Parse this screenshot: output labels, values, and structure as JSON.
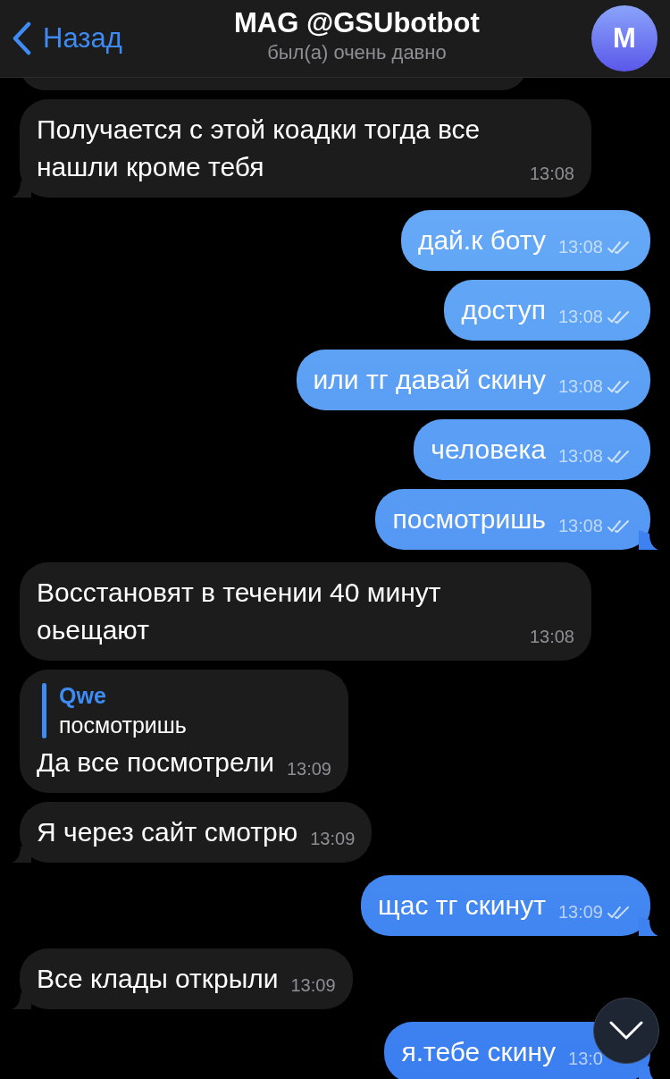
{
  "header": {
    "back_label": "Назад",
    "title": "MAG @GSUbotbot",
    "status": "был(а) очень давно",
    "avatar_initial": "M"
  },
  "messages": [
    {
      "kind": "incoming",
      "text": "Получается с этой коадки тогда все нашли кроме тебя",
      "time": "13:08"
    },
    {
      "kind": "outgoing",
      "text": "дай.к боту",
      "time": "13:08",
      "ticks": true
    },
    {
      "kind": "outgoing",
      "text": "доступ",
      "time": "13:08",
      "ticks": true
    },
    {
      "kind": "outgoing",
      "text": "или тг давай скину",
      "time": "13:08",
      "ticks": true
    },
    {
      "kind": "outgoing",
      "text": "человека",
      "time": "13:08",
      "ticks": true
    },
    {
      "kind": "outgoing",
      "text": "посмотришь",
      "time": "13:08",
      "ticks": true
    },
    {
      "kind": "incoming",
      "text": "Восстановят в течении 40 минут оьещают",
      "time": "13:08"
    },
    {
      "kind": "incoming",
      "text": "Да все посмотрели",
      "time": "13:09",
      "reply": {
        "author": "Qwe",
        "text": "посмотришь"
      }
    },
    {
      "kind": "incoming",
      "text": "Я через сайт смотрю",
      "time": "13:09"
    },
    {
      "kind": "outgoing",
      "text": "щас тг скинут",
      "time": "13:09",
      "ticks": true
    },
    {
      "kind": "incoming",
      "text": "Все клады открыли",
      "time": "13:09"
    },
    {
      "kind": "outgoing",
      "text": "я.тебе скину",
      "time": "13:0",
      "ticks": false
    }
  ]
}
